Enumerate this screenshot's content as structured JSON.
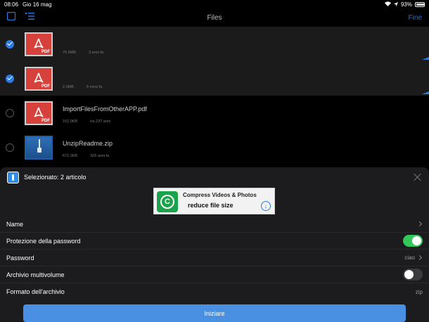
{
  "status_bar": {
    "time": "08:06",
    "date": "Gio 16 mag",
    "battery": "93%"
  },
  "nav": {
    "title": "Files",
    "done": "Fine"
  },
  "files": [
    {
      "name": "",
      "size": "75.9MB",
      "age": "3 anni fa",
      "selected": true
    },
    {
      "name": "",
      "size": "2.0MB",
      "age": "5 mesi fa",
      "selected": true
    },
    {
      "name": "ImportFilesFromOtherAPP.pdf",
      "size": "162.0KB",
      "age": "tra 237 anni",
      "selected": false
    },
    {
      "name": "UnzipReadme.zip",
      "size": "672.3KB",
      "age": "326 anni fa",
      "selected": false
    }
  ],
  "sheet": {
    "title": "Selezionato: 2 articolo",
    "ad": {
      "line1": "Compress Videos & Photos",
      "line2": "reduce file size"
    },
    "settings": [
      {
        "label": "Name",
        "value": ""
      },
      {
        "label": "Protezione della password",
        "toggle": true
      },
      {
        "label": "Password",
        "value": "ciao"
      },
      {
        "label": "Archivio multivolume",
        "toggle": false
      },
      {
        "label": "Formato dell'archivio",
        "value": "zip"
      }
    ],
    "start_label": "Iniziare"
  },
  "colors": {
    "accent": "#2c7be5",
    "toggle_on": "#34c759",
    "button": "#4a90e2",
    "sheet_bg": "#1c1c1e"
  }
}
